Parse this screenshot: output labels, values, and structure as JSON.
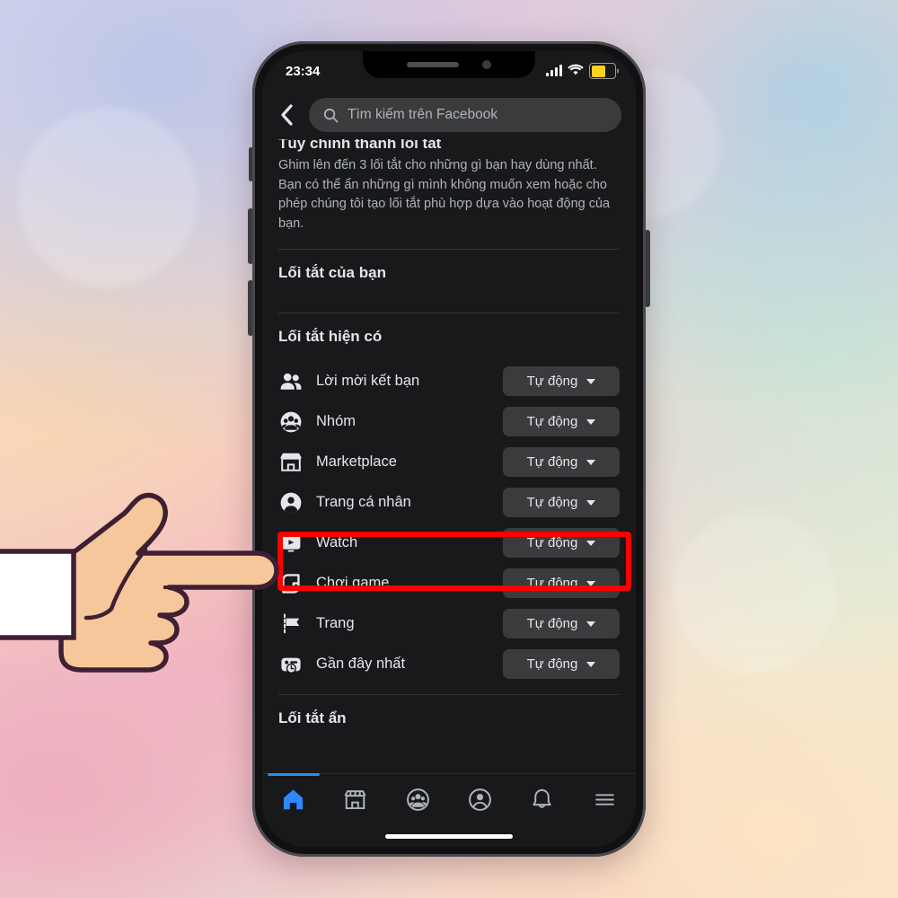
{
  "background": {
    "style": "watercolor-pastel",
    "colors": [
      "#bac6e8",
      "#ecc4d6",
      "#a8d0e6",
      "#cee8d4",
      "#fad6b0",
      "#f0b0be",
      "#fce4c4"
    ]
  },
  "device": {
    "frame_color": "#111113",
    "screen_bg": "#18191a",
    "buttons": [
      "mute-switch",
      "volume-up",
      "volume-down",
      "power"
    ]
  },
  "status_bar": {
    "time": "23:34",
    "signal_icon": "cellular-signal-icon",
    "wifi_icon": "wifi-icon",
    "battery_icon": "battery-icon",
    "battery_color": "#ffd21e",
    "battery_level_percent": 62
  },
  "header": {
    "back_icon": "back-chevron-icon",
    "search_icon": "search-icon",
    "search_placeholder": "Tìm kiếm trên Facebook",
    "search_value": ""
  },
  "intro": {
    "title": "Tùy chỉnh thanh lối tắt",
    "body": "Ghim lên đến 3 lối tắt cho những gì bạn hay dùng nhất. Bạn có thể ẩn những gì mình không muốn xem hoặc cho phép chúng tôi tạo lối tắt phù hợp dựa vào hoạt động của bạn."
  },
  "sections": {
    "your_shortcuts": "Lối tắt của bạn",
    "available_shortcuts": "Lối tắt hiện có",
    "hidden_shortcuts": "Lối tắt ẩn"
  },
  "shortcuts": [
    {
      "icon": "friends-icon",
      "label": "Lời mời kết bạn",
      "value": "Tự động",
      "highlighted": false
    },
    {
      "icon": "groups-icon",
      "label": "Nhóm",
      "value": "Tự động",
      "highlighted": false
    },
    {
      "icon": "marketplace-icon",
      "label": "Marketplace",
      "value": "Tự động",
      "highlighted": false
    },
    {
      "icon": "profile-icon",
      "label": "Trang cá nhân",
      "value": "Tự động",
      "highlighted": false
    },
    {
      "icon": "watch-icon",
      "label": "Watch",
      "value": "Tự động",
      "highlighted": true
    },
    {
      "icon": "gaming-icon",
      "label": "Chơi game",
      "value": "Tự động",
      "highlighted": false
    },
    {
      "icon": "pages-icon",
      "label": "Trang",
      "value": "Tự động",
      "highlighted": false
    },
    {
      "icon": "recent-icon",
      "label": "Gần đây nhất",
      "value": "Tự động",
      "highlighted": false
    }
  ],
  "bottom_nav": [
    {
      "icon": "home-icon",
      "active": true
    },
    {
      "icon": "marketplace-icon",
      "active": false
    },
    {
      "icon": "groups-icon",
      "active": false
    },
    {
      "icon": "profile-icon",
      "active": false
    },
    {
      "icon": "notifications-icon",
      "active": false
    },
    {
      "icon": "menu-icon",
      "active": false
    }
  ],
  "annotation": {
    "highlight_color": "#ff0000",
    "target_label": "Watch",
    "pointer": "pointing-hand-illustration"
  }
}
